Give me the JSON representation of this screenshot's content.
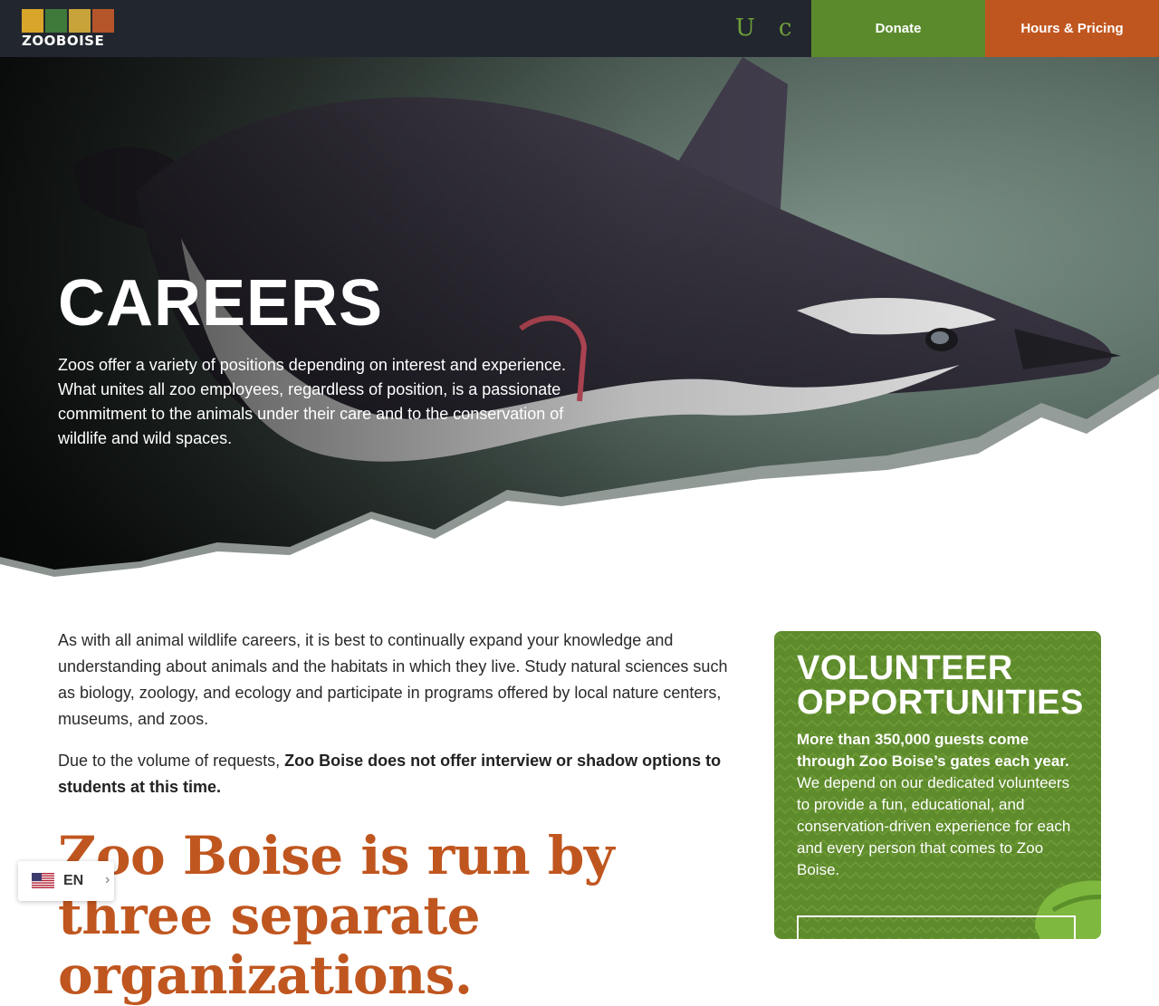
{
  "header": {
    "logo_text": "ZOOBOISE",
    "utility_icons": [
      {
        "glyph": "U",
        "icon": "utility-icon-u"
      },
      {
        "glyph": "c",
        "icon": "utility-icon-c"
      }
    ],
    "donate_label": "Donate",
    "hours_label": "Hours & Pricing"
  },
  "hero": {
    "title": "CAREERS",
    "text": "Zoos offer a variety of positions depending on interest and experience. What unites all zoo employees, regardless of position, is a passionate commitment to the animals under their care and to the conservation of wildlife and wild spaces."
  },
  "main": {
    "paragraph1": "As with all animal wildlife careers, it is best to continually expand your knowledge and understanding about animals and the habitats in which they live. Study natural sciences such as biology, zoology, and ecology and participate in programs offered by local nature centers, museums, and zoos.",
    "paragraph2_intro": "Due to the volume of requests, ",
    "paragraph2_bold": "Zoo Boise does not offer interview or shadow options to students at this time.",
    "orgs_heading": "Zoo Boise is run by three separate organizations."
  },
  "volunteer": {
    "title": "VOLUNTEER OPPORTUNITIES",
    "text_bold": "More than 350,000 guests come through Zoo Boise’s gates each year.",
    "text_rest": " We depend on our dedicated volunteers to provide a fun, educational, and conservation-driven experience for each and every person that comes to Zoo Boise."
  },
  "language": {
    "code": "EN",
    "chevron": "›"
  },
  "colors": {
    "header_bg": "#22262e",
    "donate_bg": "#5b8a2c",
    "hours_bg": "#c0561f",
    "accent_orange": "#c0561f",
    "card_green": "#5e8b2b"
  }
}
